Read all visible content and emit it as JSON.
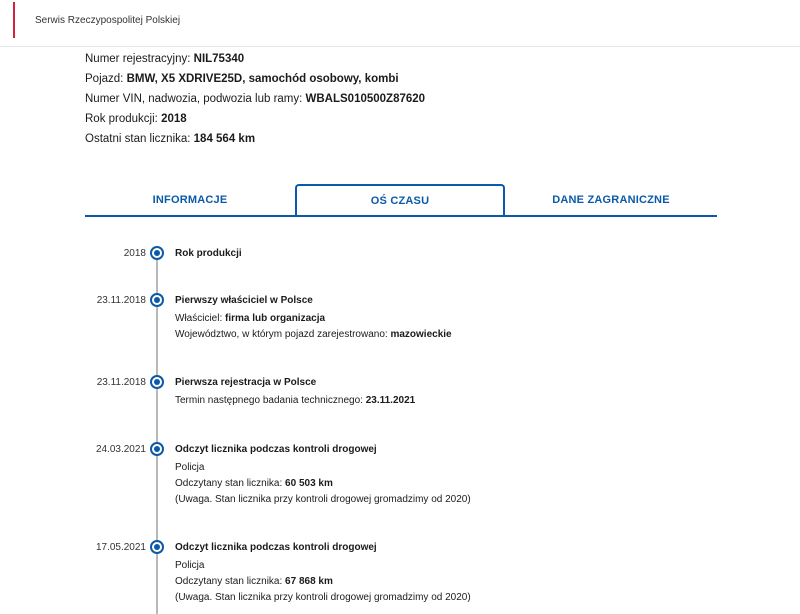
{
  "header": {
    "title": "Serwis Rzeczypospolitej Polskiej"
  },
  "vehicle": {
    "reg_label": "Numer rejestracyjny: ",
    "reg_value": "NIL75340",
    "vehicle_label": "Pojazd: ",
    "vehicle_value": "BMW, X5 XDRIVE25D, samochód osobowy, kombi",
    "vin_label": "Numer VIN, nadwozia, podwozia lub ramy: ",
    "vin_value": "WBALS010500Z87620",
    "year_label": "Rok produkcji: ",
    "year_value": "2018",
    "odo_label": "Ostatni stan licznika: ",
    "odo_value": "184 564 km"
  },
  "tabs": {
    "info": "INFORMACJE",
    "timeline": "OŚ CZASU",
    "foreign": "DANE ZAGRANICZNE"
  },
  "events": [
    {
      "date": "2018",
      "title": "Rok produkcji"
    },
    {
      "date": "23.11.2018",
      "title": "Pierwszy właściciel w Polsce",
      "d1_label": "Właściciel: ",
      "d1_value": "firma lub organizacja",
      "d2_label": "Województwo, w którym pojazd zarejestrowano: ",
      "d2_value": "mazowieckie"
    },
    {
      "date": "23.11.2018",
      "title": "Pierwsza rejestracja w Polsce",
      "d1_label": "Termin następnego badania technicznego: ",
      "d1_value": "23.11.2021"
    },
    {
      "date": "24.03.2021",
      "title": "Odczyt licznika podczas kontroli drogowej",
      "d0": "Policja",
      "d1_label": "Odczytany stan licznika: ",
      "d1_value": "60 503 km",
      "note": "(Uwaga. Stan licznika przy kontroli drogowej gromadzimy od 2020)"
    },
    {
      "date": "17.05.2021",
      "title": "Odczyt licznika podczas kontroli drogowej",
      "d0": "Policja",
      "d1_label": "Odczytany stan licznika: ",
      "d1_value": "67 868 km",
      "note": "(Uwaga. Stan licznika przy kontroli drogowej gromadzimy od 2020)"
    }
  ],
  "colors": {
    "accent": "#0a5aa8",
    "flag_red": "#d4213d",
    "line": "#b8b8b8"
  }
}
